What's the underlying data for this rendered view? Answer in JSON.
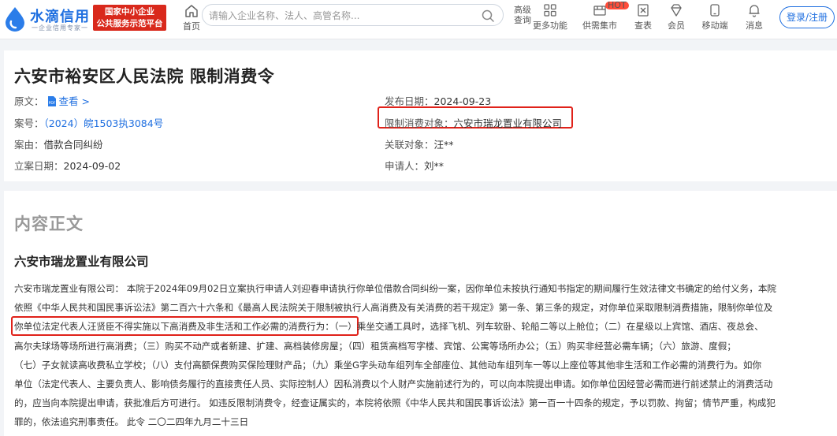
{
  "header": {
    "logo_text": "水滴信用",
    "logo_sub": "一企业信用专家一",
    "platform_line1": "国家中小企业",
    "platform_line2": "公共服务示范平台",
    "home_label": "首页",
    "search_placeholder": "请输入企业名称、法人、高管名称...",
    "adv_search_label": "高级查询",
    "nav_items": [
      {
        "label": "更多功能",
        "icon": "grid-icon"
      },
      {
        "label": "供需集市",
        "icon": "market-icon",
        "badge": "HOT"
      },
      {
        "label": "查表",
        "icon": "excel-icon"
      },
      {
        "label": "会员",
        "icon": "diamond-icon"
      },
      {
        "label": "移动端",
        "icon": "mobile-icon"
      },
      {
        "label": "消息",
        "icon": "bell-icon"
      }
    ],
    "login_label": "登录/注册",
    "colors": {
      "brand": "#1f6fe0",
      "badge_red": "#d9291c"
    }
  },
  "detail": {
    "title": "六安市裕安区人民法院 限制消费令",
    "original_label": "原文：",
    "original_link": "查看 >",
    "case_no_label": "案号：",
    "case_no": "（2024）皖1503执3084号",
    "cause_label": "案由：",
    "cause": "借款合同纠纷",
    "filing_date_label": "立案日期：",
    "filing_date": "2024-09-02",
    "publish_date_label": "发布日期：",
    "publish_date": "2024-09-23",
    "target_label": "限制消费对象：",
    "target": "六安市瑞龙置业有限公司",
    "related_label": "关联对象：",
    "related": "汪**",
    "applicant_label": "申请人：",
    "applicant": "刘**",
    "highlight_color": "#e0221a"
  },
  "content": {
    "section_title": "内容正文",
    "company": "六安市瑞龙置业有限公司",
    "lines": [
      "六安市瑞龙置业有限公司： 本院于2024年09月02日立案执行申请人刘迎春申请执行你单位借款合同纠纷一案，因你单位未按执行通知书指定的期间履行生效法律文书确定的给付义务，本院",
      "依照《中华人民共和国民事诉讼法》第二百六十六条和《最高人民法院关于限制被执行人高消费及有关消费的若干规定》第一条、第三条的规定，对你单位采取限制消费措施，限制你单位及",
      "你单位法定代表人汪贤臣不得实施以下高消费及非生活和工作必需的消费行为：（一）乘坐交通工具时，选择飞机、列车软卧、轮船二等以上舱位；（二）在星级以上宾馆、酒店、夜总会、",
      "高尔夫球场等场所进行高消费；（三）购买不动产或者新建、扩建、高档装修房屋；（四）租赁高档写字楼、宾馆、公寓等场所办公；（五）购买非经营必需车辆；（六）旅游、度假；",
      "（七）子女就读高收费私立学校；（八）支付高额保费购买保险理财产品；（九）乘坐G字头动车组列车全部座位、其他动车组列车一等以上座位等其他非生活和工作必需的消费行为。如你",
      "单位（法定代表人、主要负责人、影响债务履行的直接责任人员、实际控制人）因私消费以个人财产实施前述行为的，可以向本院提出申请。如你单位因经营必需而进行前述禁止的消费活动",
      "的，应当向本院提出申请，获批准后方可进行。 如违反限制消费令，经查证属实的，本院将依照《中华人民共和国民事诉讼法》第一百一十四条的规定，予以罚款、拘留；情节严重，构成犯",
      "罪的，依法追究刑事责任。 此令 二〇二四年九月二十三日"
    ]
  }
}
